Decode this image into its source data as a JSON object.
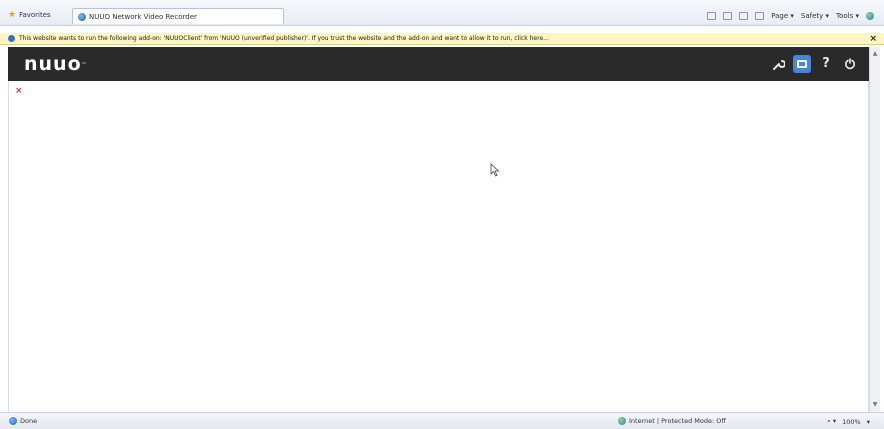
{
  "favorites_bar": {
    "favorites_label": "Favorites",
    "tab_title": "NUUO Network Video Recorder"
  },
  "command_bar": {
    "items": [
      "Page ▾",
      "Safety ▾",
      "Tools ▾"
    ]
  },
  "info_bar": {
    "message": "This website wants to run the following add-on: 'NUUOClient' from 'NUUO (unverified publisher)'. If you trust the website and the add-on and want to allow it to run, click here..."
  },
  "nuuo_header": {
    "logo": "nuuo",
    "logo_tm": "™",
    "help_label": "?"
  },
  "status_bar": {
    "status": "Done",
    "zone": "Internet | Protected Mode: Off",
    "zoom": "100%"
  },
  "colors": {
    "header_bg": "#2a2a2a",
    "info_bar_bg": "#fbf6c2",
    "active_tool": "#4a86d8"
  }
}
